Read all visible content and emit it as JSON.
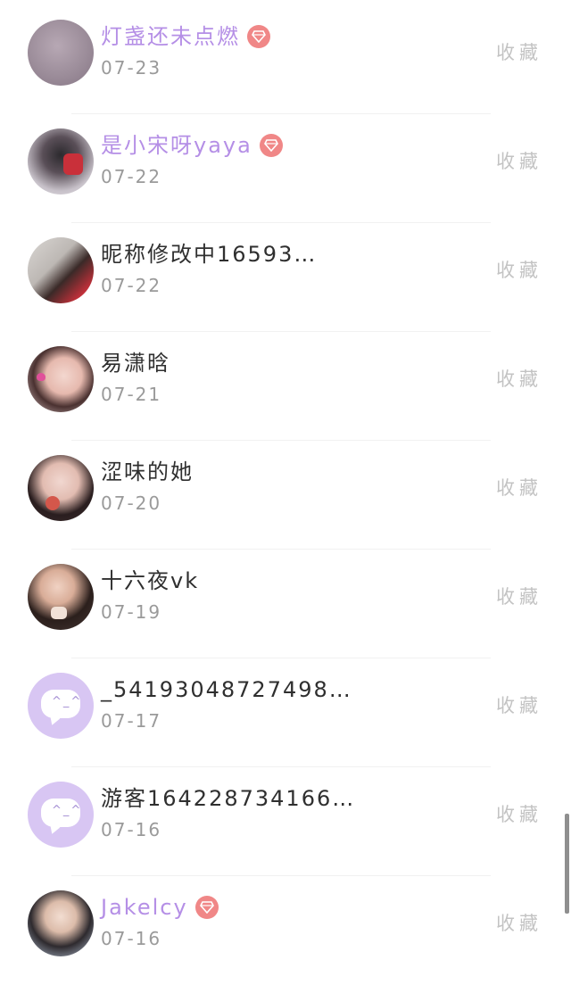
{
  "favorite_label": "收藏",
  "vip_icon": "diamond-icon",
  "colors": {
    "vip_name": "#b58fe6",
    "vip_badge": "#f08787",
    "default_avatar": "#d8c6f3"
  },
  "users": [
    {
      "name": "灯盏还未点燃",
      "date": "07-23",
      "vip": true,
      "avatar": {
        "type": "photo",
        "description": "grey-purple"
      }
    },
    {
      "name": "是小宋呀yaya",
      "date": "07-22",
      "vip": true,
      "avatar": {
        "type": "photo",
        "description": "figure in black hat"
      }
    },
    {
      "name": "昵称修改中16593…",
      "date": "07-22",
      "vip": false,
      "avatar": {
        "type": "photo",
        "description": "woman in red"
      }
    },
    {
      "name": "易潇晗",
      "date": "07-21",
      "vip": false,
      "avatar": {
        "type": "photo",
        "description": "smiling woman"
      }
    },
    {
      "name": "涩味的她",
      "date": "07-20",
      "vip": false,
      "avatar": {
        "type": "photo",
        "description": "woman with drink"
      }
    },
    {
      "name": "十六夜vk",
      "date": "07-19",
      "vip": false,
      "avatar": {
        "type": "photo",
        "description": "woman posing"
      }
    },
    {
      "name": "_54193048727498…",
      "date": "07-17",
      "vip": false,
      "avatar": {
        "type": "default",
        "description": "chat bubble"
      }
    },
    {
      "name": "游客164228734166…",
      "date": "07-16",
      "vip": false,
      "avatar": {
        "type": "default",
        "description": "chat bubble"
      }
    },
    {
      "name": "Jakelcy",
      "date": "07-16",
      "vip": true,
      "avatar": {
        "type": "photo",
        "description": "young man"
      }
    }
  ]
}
